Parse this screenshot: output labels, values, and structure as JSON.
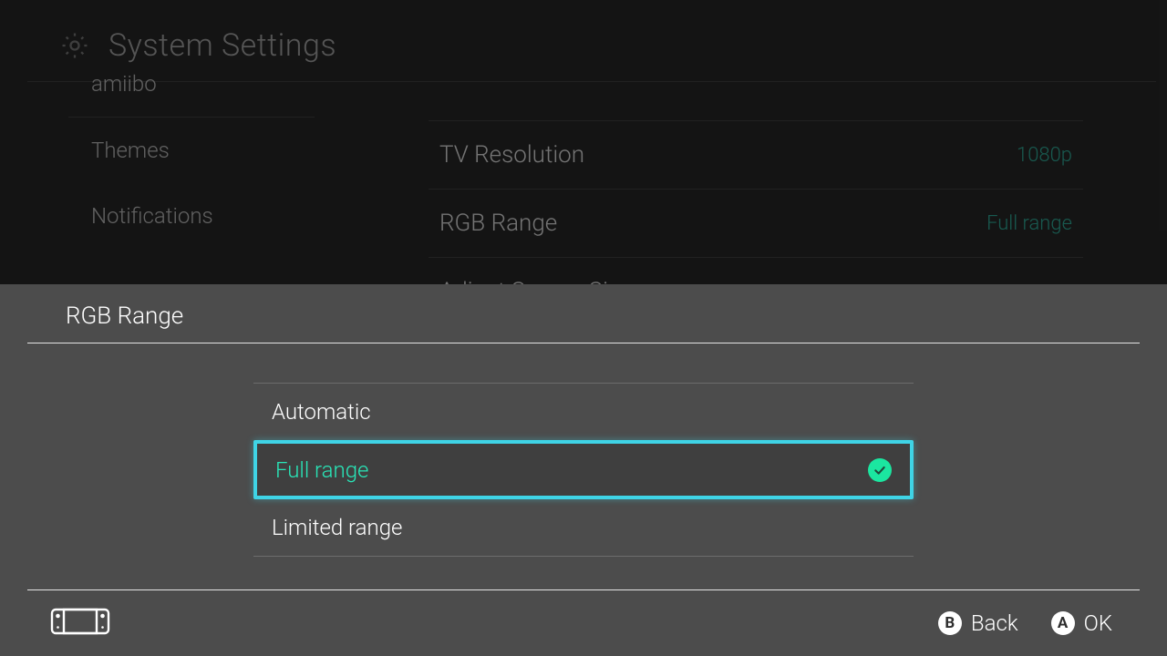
{
  "header": {
    "title": "System Settings"
  },
  "sidebar": {
    "items": [
      {
        "label": "amiibo"
      },
      {
        "label": "Themes"
      },
      {
        "label": "Notifications"
      }
    ]
  },
  "main": {
    "rows": [
      {
        "label": "TV Resolution",
        "value": "1080p"
      },
      {
        "label": "RGB Range",
        "value": "Full range"
      },
      {
        "label": "Adjust Screen Size",
        "value": ""
      }
    ]
  },
  "overlay": {
    "title": "RGB Range",
    "options": [
      {
        "label": "Automatic",
        "selected": false
      },
      {
        "label": "Full range",
        "selected": true
      },
      {
        "label": "Limited range",
        "selected": false
      }
    ]
  },
  "footer": {
    "back": {
      "button": "B",
      "label": "Back"
    },
    "ok": {
      "button": "A",
      "label": "OK"
    }
  }
}
